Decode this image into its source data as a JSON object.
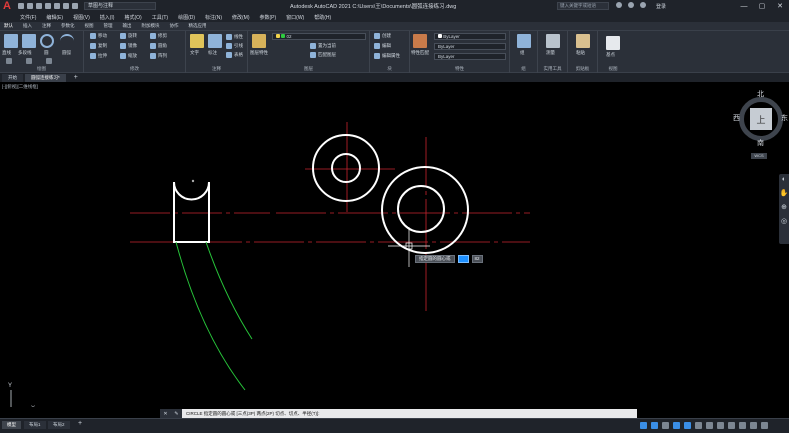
{
  "titlebar": {
    "app_logo": "A",
    "workspace": "草图与注释",
    "title": "Autodesk AutoCAD 2021    C:\\Users\\王\\Documents\\圆弧连接练习.dwg",
    "search_placeholder": "键入关键字或短语",
    "user": "登录",
    "minimize": "—",
    "maximize": "▢",
    "close": "✕"
  },
  "menubar": {
    "items": [
      "文件(F)",
      "编辑(E)",
      "视图(V)",
      "插入(I)",
      "格式(O)",
      "工具(T)",
      "绘图(D)",
      "标注(N)",
      "修改(M)",
      "参数(P)",
      "窗口(W)",
      "帮助(H)"
    ]
  },
  "ribbon_tabs": {
    "items": [
      "默认",
      "插入",
      "注释",
      "参数化",
      "视图",
      "管理",
      "输出",
      "附加模块",
      "协作",
      "精选应用"
    ]
  },
  "ribbon": {
    "draw": {
      "title": "绘图",
      "line": "直线",
      "polyline": "多段线",
      "circle": "圆",
      "arc": "圆弧"
    },
    "modify": {
      "title": "修改",
      "move": "移动",
      "rotate": "旋转",
      "trim": "修剪",
      "copy": "复制",
      "mirror": "镜像",
      "fillet": "圆角",
      "stretch": "拉伸",
      "scale": "缩放",
      "array": "阵列"
    },
    "annotation": {
      "title": "注释",
      "text": "文字",
      "dimension": "标注",
      "linear": "线性",
      "leader": "引线",
      "table": "表格"
    },
    "layers": {
      "title": "图层",
      "properties": "图层特性",
      "current_layer": "02",
      "match": "置为当前",
      "match_layer": "匹配图层"
    },
    "block": {
      "title": "块",
      "insert": "插入",
      "create": "创建",
      "edit": "编辑",
      "edit_attr": "编辑属性"
    },
    "properties": {
      "title": "特性",
      "match": "特性匹配",
      "color": "ByLayer",
      "linetype": "ByLayer",
      "lineweight": "ByLayer"
    },
    "groups": {
      "title": "组",
      "group": "组"
    },
    "utilities": {
      "title": "实用工具",
      "measure": "测量"
    },
    "clipboard": {
      "title": "剪贴板",
      "paste": "粘贴"
    },
    "view": {
      "title": "视图",
      "base": "基点"
    }
  },
  "filetabs": {
    "items": [
      "开始",
      "圆弧连接练习*"
    ],
    "plus": "+"
  },
  "canvas": {
    "view_label": "[-][俯视][二维线框]"
  },
  "viewcube": {
    "face": "上",
    "north": "北",
    "south": "南",
    "east": "东",
    "west": "西",
    "wcs": "WCS"
  },
  "ucs": {
    "y": "Y",
    "x": "X"
  },
  "dynamic_input": {
    "prompt": "指定圆的圆心或",
    "value": "82"
  },
  "command_line": {
    "text": "CIRCLE 指定圆的圆心或 [三点(3P) 两点(2P) 切点、切点、半径(T)]:"
  },
  "statusbar": {
    "layouts": [
      "模型",
      "布局1",
      "布局2"
    ]
  }
}
